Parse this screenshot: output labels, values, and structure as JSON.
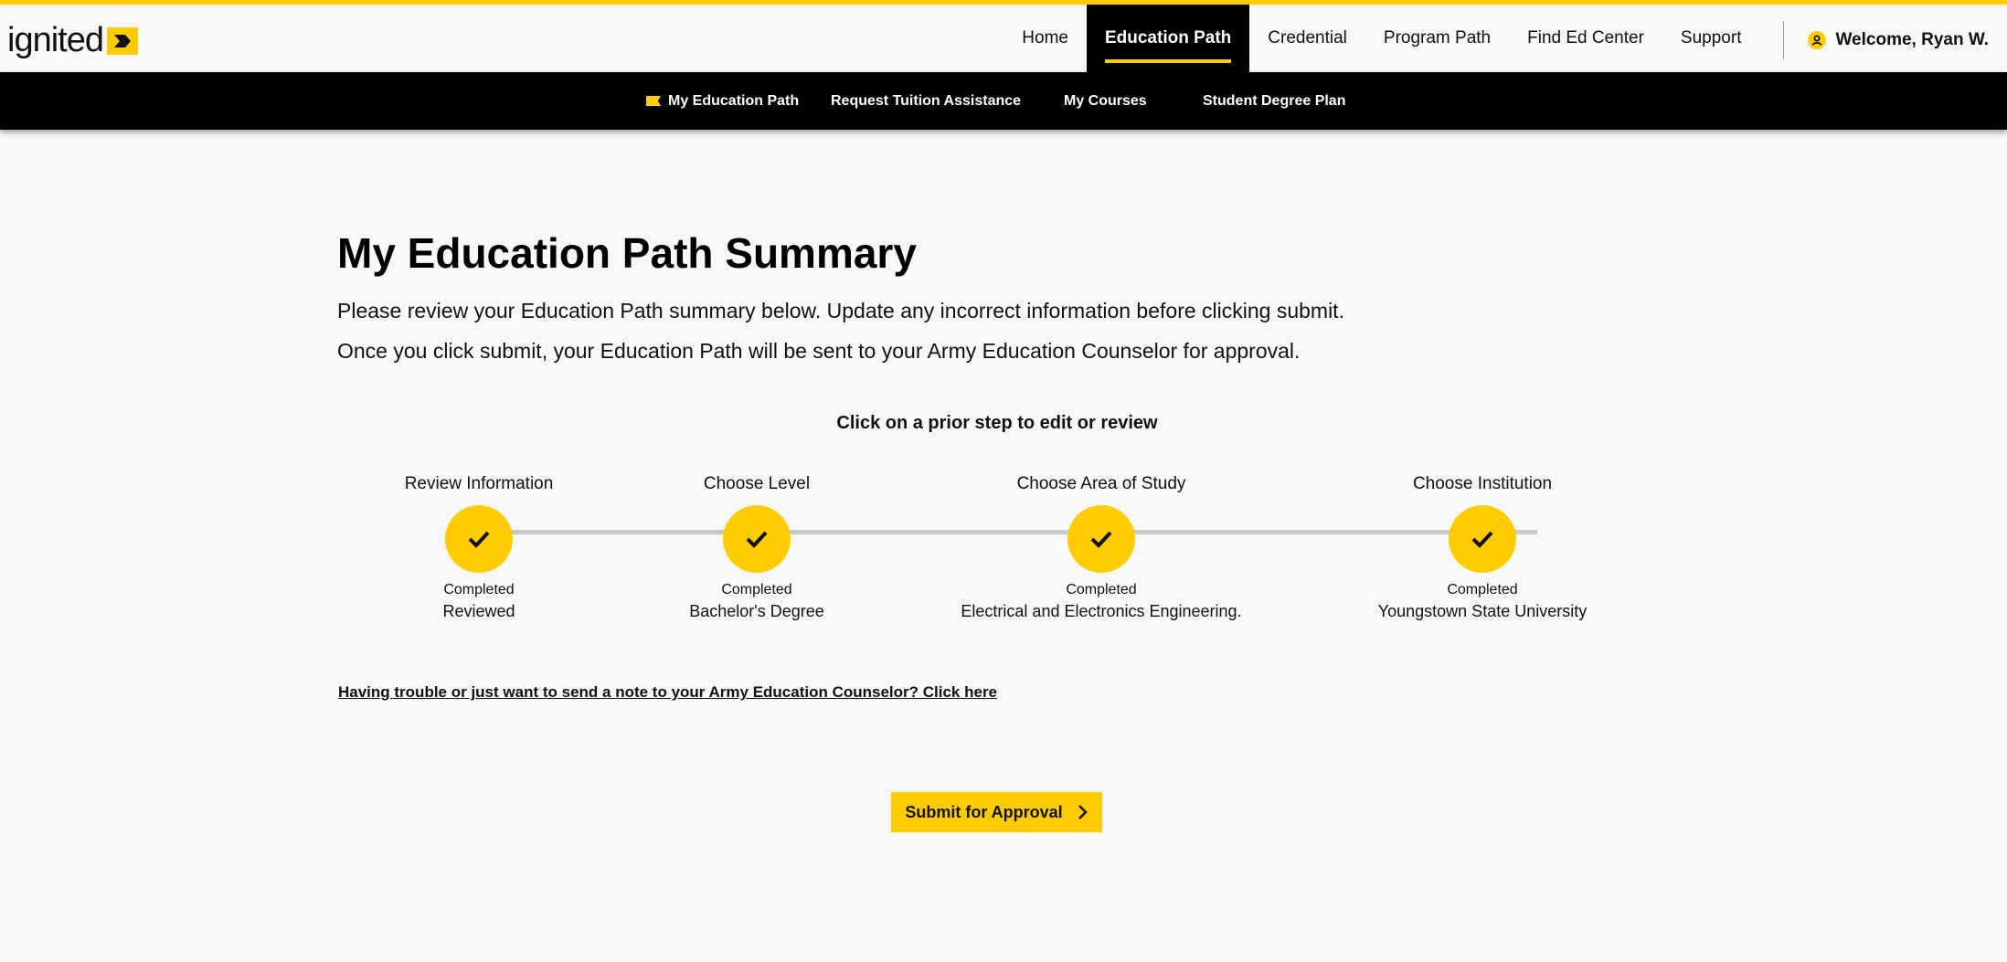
{
  "brand": {
    "logo_text": "ignited"
  },
  "colors": {
    "accent": "#ffcc00",
    "nav_dark": "#000000",
    "background": "#f8f8f8",
    "stepper_line": "#c8c8c8"
  },
  "nav": {
    "items": [
      {
        "label": "Home",
        "active": false
      },
      {
        "label": "Education Path",
        "active": true
      },
      {
        "label": "Credential",
        "active": false
      },
      {
        "label": "Program Path",
        "active": false
      },
      {
        "label": "Find Ed Center",
        "active": false
      },
      {
        "label": "Support",
        "active": false
      }
    ],
    "welcome": "Welcome, Ryan W."
  },
  "subnav": {
    "items": [
      {
        "label": "My Education Path",
        "icon": "flag-icon"
      },
      {
        "label": "Request Tuition Assistance"
      },
      {
        "label": "My Courses"
      },
      {
        "label": "Student Degree Plan"
      }
    ]
  },
  "main": {
    "title": "My Education Path Summary",
    "intro_line1": "Please review your Education Path summary below. Update any incorrect information before clicking submit.",
    "intro_line2": "Once you click submit, your Education Path will be sent to your Army Education Counselor for approval.",
    "click_hint": "Click on a prior step to edit or review",
    "steps": [
      {
        "title": "Review Information",
        "status": "Completed",
        "value": "Reviewed"
      },
      {
        "title": "Choose Level",
        "status": "Completed",
        "value": "Bachelor's Degree"
      },
      {
        "title": "Choose Area of Study",
        "status": "Completed",
        "value": "Electrical and Electronics Engineering."
      },
      {
        "title": "Choose Institution",
        "status": "Completed",
        "value": "Youngstown State University"
      }
    ],
    "counselor_link": "Having trouble or just want to send a note to your Army Education Counselor? Click here",
    "submit_label": "Submit for Approval"
  }
}
